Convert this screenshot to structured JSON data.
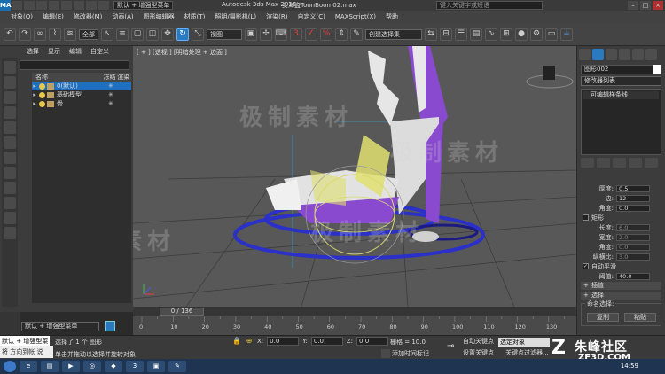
{
  "titlebar": {
    "workspace": "默认 + 增强型菜单",
    "app_title": "Autodesk 3ds Max  2015",
    "file_title": "女海盗ToonBoom02.max",
    "help_search_placeholder": "键入关键字或短语",
    "logo": "MAX"
  },
  "menu": [
    "对象(O)",
    "编辑(E)",
    "修改器(M)",
    "动画(A)",
    "图形编辑器",
    "材质(T)",
    "照明/摄影机(L)",
    "渲染(R)",
    "自定义(C)",
    "MAXScript(X)",
    "帮助"
  ],
  "toolbar": {
    "selection_filter": "全部",
    "reference_coord": "视图",
    "named_selection": "创建选择集"
  },
  "explorer": {
    "menu": [
      "选择",
      "显示",
      "编辑",
      "自定义"
    ],
    "columns": [
      "名称",
      "冻结",
      "渲染"
    ],
    "rows": [
      {
        "label": "0(默认)",
        "selected": true
      },
      {
        "label": "基础模型",
        "selected": false
      },
      {
        "label": "骨",
        "selected": false
      }
    ],
    "layer_dropdown": "默认 + 增强型菜单"
  },
  "viewport": {
    "label": "[ + ] [透视 ] [明暗处理 + 边面 ]"
  },
  "command_panel": {
    "object_name": "图形002",
    "modifier_list": "修改器列表",
    "stack_item": "可编辑样条线",
    "params": [
      {
        "label": "厚度:",
        "value": "0.5",
        "dim": false
      },
      {
        "label": "边:",
        "value": "12",
        "dim": false
      },
      {
        "label": "角度:",
        "value": "0.0",
        "dim": false
      }
    ],
    "rect_label": "矩形",
    "rect_params": [
      {
        "label": "长度:",
        "value": "6.0",
        "dim": true
      },
      {
        "label": "宽度:",
        "value": "2.0",
        "dim": true
      },
      {
        "label": "角度:",
        "value": "0.0",
        "dim": true
      },
      {
        "label": "纵横比:",
        "value": "3.0",
        "dim": true
      }
    ],
    "auto_smooth": "自动平滑",
    "threshold_label": "阈值:",
    "threshold_value": "40.0",
    "rollout_interp": "插值",
    "rollout_select": "选择",
    "named_sel_label": "命名选择:",
    "copy_btn": "复制",
    "paste_btn": "粘贴"
  },
  "timeline": {
    "frame": "0 / 136",
    "ticks": [
      "0",
      "10",
      "20",
      "30",
      "40",
      "50",
      "60",
      "70",
      "80",
      "90",
      "100",
      "110",
      "120",
      "130"
    ]
  },
  "statusbar": {
    "maxscript": "默认 + 增强型菜单",
    "selected": "选择了 1 个 图形",
    "prompt": "单击并拖动以选择并旋转对象",
    "x_label": "X:",
    "x_value": "0.0",
    "y_label": "Y:",
    "y_value": "0.0",
    "z_label": "Z:",
    "z_value": "0.0",
    "grid": "栅格 = 10.0",
    "add_time_tag": "添加时间标记",
    "auto_key": "自动关键点",
    "set_key": "设置关键点",
    "key_filter_dd": "选定对象",
    "key_filters": "关键点过滤器...",
    "bottom_left": "将 方向到帐 说"
  },
  "watermark": {
    "site_cn": "朱峰社区",
    "site_url": "ZF3D.COM",
    "overlay": "极制素材"
  },
  "taskbar": {
    "clock": "14:59"
  },
  "colors": {
    "accent": "#2a7ac0",
    "viewport_bg": "#585858",
    "selection_yellow": "#e0e070",
    "spline_blue": "#2a30c8",
    "shoe_purple": "#8a4ad0"
  }
}
